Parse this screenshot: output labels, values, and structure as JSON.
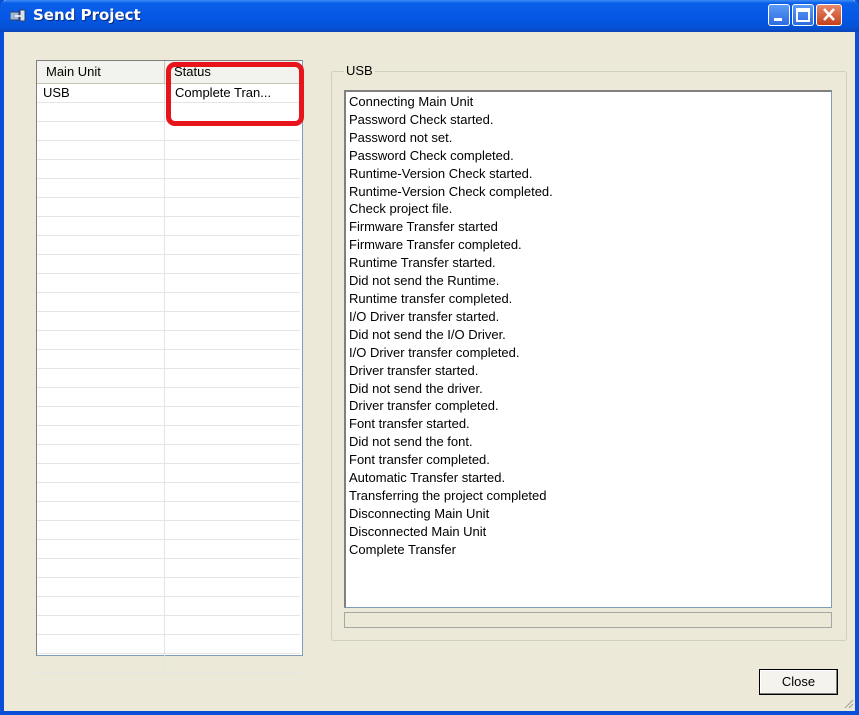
{
  "window": {
    "title": "Send Project",
    "title_icon": "send-project-icon"
  },
  "title_buttons": {
    "minimize": "minimize-icon",
    "maximize": "maximize-icon",
    "close": "close-icon"
  },
  "list": {
    "columns": [
      "Main Unit",
      "Status"
    ],
    "rows": [
      {
        "unit": "USB",
        "status": "Complete Tran..."
      }
    ],
    "empty_rows": 30
  },
  "log_group": {
    "label": "USB",
    "lines": [
      "Connecting Main Unit",
      "Password Check started.",
      "Password not set.",
      "Password Check completed.",
      "Runtime-Version Check started.",
      "Runtime-Version Check completed.",
      "Check project file.",
      "Firmware Transfer started",
      "Firmware Transfer completed.",
      "Runtime Transfer started.",
      "Did not send the Runtime.",
      "Runtime transfer completed.",
      "I/O Driver transfer started.",
      "Did not send the I/O Driver.",
      "I/O Driver transfer completed.",
      "Driver transfer started.",
      "Did not send the driver.",
      "Driver transfer completed.",
      "Font transfer started.",
      "Did not send the font.",
      "Font transfer completed.",
      "Automatic Transfer started.",
      "Transferring the project completed",
      "Disconnecting Main Unit",
      "Disconnected Main Unit",
      "Complete Transfer"
    ],
    "progress": 0
  },
  "buttons": {
    "close": "Close"
  },
  "colors": {
    "title_bar": "#0558E6",
    "highlight": "#E8141C",
    "dialog_bg": "#ECE9D8"
  }
}
